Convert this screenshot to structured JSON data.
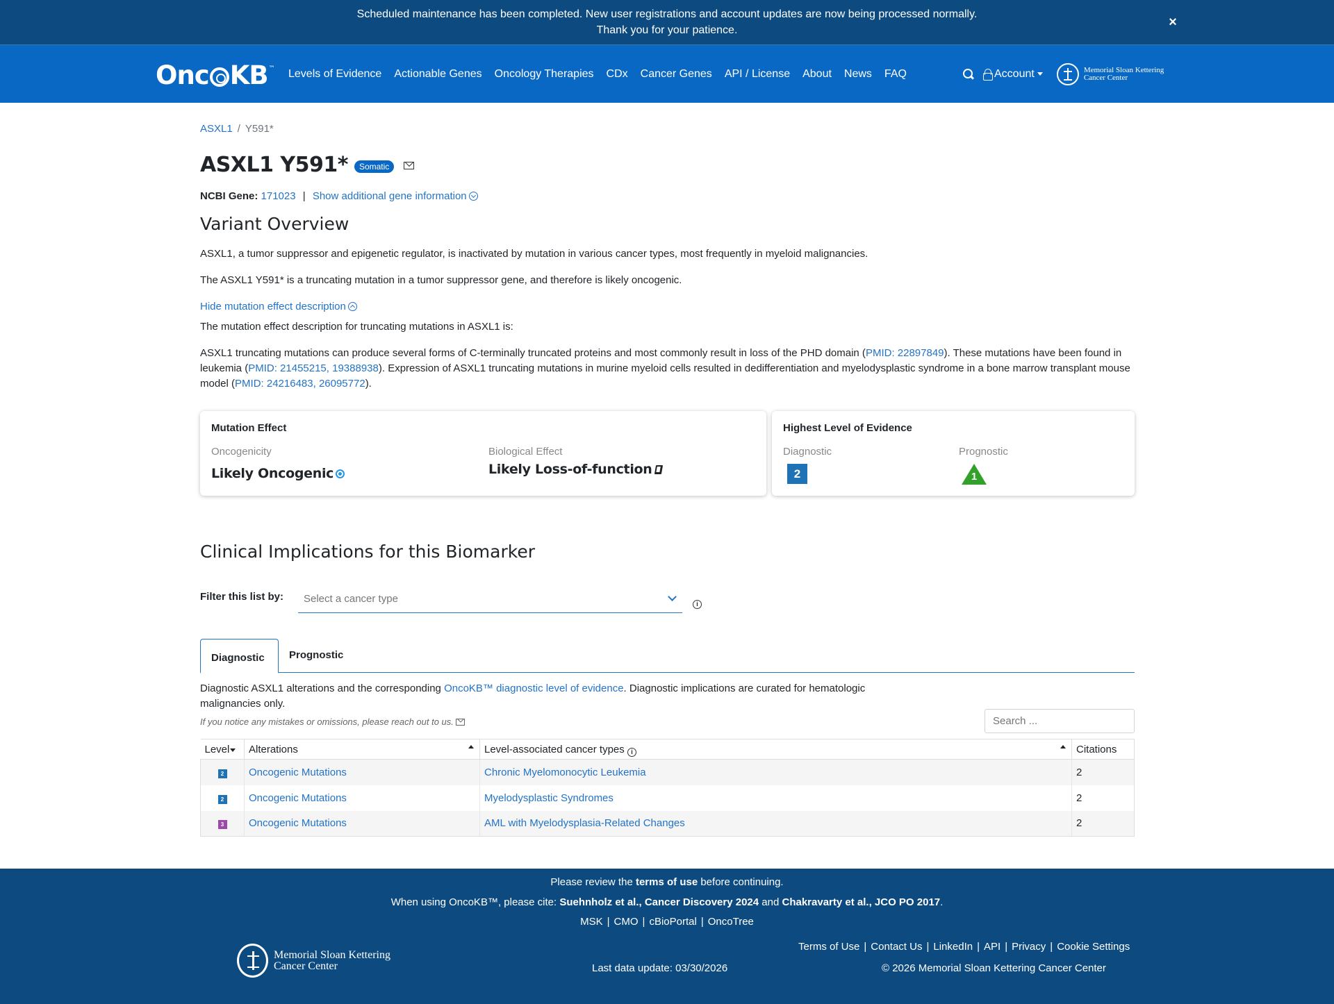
{
  "announcement": {
    "text": "Scheduled maintenance has been completed. New user registrations and account updates are now being processed normally. Thank you for your patience.",
    "close_label": "×"
  },
  "nav": {
    "logo_prefix": "Onc",
    "logo_suffix": "KB",
    "logo_tm": "™",
    "links": [
      "Levels of Evidence",
      "Actionable Genes",
      "Oncology Therapies",
      "CDx",
      "Cancer Genes",
      "API / License",
      "About",
      "News",
      "FAQ"
    ],
    "account_label": "Account",
    "msk_line1": "Memorial Sloan Kettering",
    "msk_line2": "Cancer Center"
  },
  "breadcrumb": {
    "gene": "ASXL1",
    "variant": "Y591*"
  },
  "header": {
    "title": "ASXL1 Y591*",
    "badge": "Somatic",
    "ncbi_label": "NCBI Gene:",
    "ncbi_id": "171023",
    "separator": "|",
    "show_more": "Show additional gene information"
  },
  "overview": {
    "heading": "Variant Overview",
    "p1": "ASXL1, a tumor suppressor and epigenetic regulator, is inactivated by mutation in various cancer types, most frequently in myeloid malignancies.",
    "p2": "The ASXL1 Y591* is a truncating mutation in a tumor suppressor gene, and therefore is likely oncogenic.",
    "toggle": "Hide mutation effect description",
    "p3": "The mutation effect description for truncating mutations in ASXL1 is:",
    "p4_a": "ASXL1 truncating mutations can produce several forms of C-terminally truncated proteins and most commonly result in loss of the PHD domain (",
    "p4_link1": "PMID: 22897849",
    "p4_b": "). These mutations have been found in leukemia (",
    "p4_link2": "PMID: 21455215, 19388938",
    "p4_c": "). Expression of ASXL1 truncating mutations in murine myeloid cells resulted in dedifferentiation and myelodysplastic syndrome in a bone marrow transplant mouse model (",
    "p4_link3": "PMID: 24216483, 26095772",
    "p4_d": ")."
  },
  "mutation_effect": {
    "title": "Mutation Effect",
    "oncogenicity_label": "Oncogenicity",
    "oncogenicity_value": "Likely Oncogenic",
    "bio_label": "Biological Effect",
    "bio_value": "Likely Loss-of-function"
  },
  "highest_level": {
    "title": "Highest Level of Evidence",
    "diagnostic_label": "Diagnostic",
    "diagnostic_value": "2",
    "prognostic_label": "Prognostic",
    "prognostic_value": "1",
    "diagnostic_color": "#1e73b6",
    "prognostic_color": "#33a02c"
  },
  "clinical": {
    "heading": "Clinical Implications for this Biomarker",
    "filter_label": "Filter this list by:",
    "filter_placeholder": "Select a cancer type",
    "info_glyph": "i",
    "tabs": [
      "Diagnostic",
      "Prognostic"
    ],
    "desc_a": "Diagnostic ASXL1 alterations and the corresponding ",
    "desc_link": "OncoKB™ diagnostic level of evidence",
    "desc_b": ". Diagnostic implications are curated for hematologic malignancies only.",
    "note": "If you notice any mistakes or omissions, please reach out to us.",
    "search_placeholder": "Search ...",
    "columns": [
      "Level",
      "Alterations",
      "Level-associated cancer types",
      "Citations"
    ],
    "rows": [
      {
        "level": "2",
        "level_color": "#1e73b6",
        "alteration": "Oncogenic Mutations",
        "cancer_type": "Chronic Myelomonocytic Leukemia",
        "citations": "2"
      },
      {
        "level": "2",
        "level_color": "#1e73b6",
        "alteration": "Oncogenic Mutations",
        "cancer_type": "Myelodysplastic Syndromes",
        "citations": "2"
      },
      {
        "level": "3",
        "level_color": "#9b4aa8",
        "alteration": "Oncogenic Mutations",
        "cancer_type": "AML with Myelodysplasia-Related Changes",
        "citations": "2"
      }
    ]
  },
  "footer": {
    "review_a": "Please review the ",
    "review_link": "terms of use",
    "review_b": " before continuing.",
    "cite_a": "When using OncoKB™, please cite: ",
    "cite_b": "Suehnholz et al., Cancer Discovery 2024",
    "cite_c": " and ",
    "cite_d": "Chakravarty et al., JCO PO 2017",
    "cite_e": ".",
    "partner_links": [
      "MSK",
      "CMO",
      "cBioPortal",
      "OncoTree"
    ],
    "msk_line1": "Memorial Sloan Kettering",
    "msk_line2": "Cancer Center",
    "last_update": "Last data update: 03/30/2026",
    "legal_links": [
      "Terms of Use",
      "Contact Us",
      "LinkedIn",
      "API",
      "Privacy",
      "Cookie Settings"
    ],
    "copyright": "© 2026 Memorial Sloan Kettering Cancer Center"
  }
}
